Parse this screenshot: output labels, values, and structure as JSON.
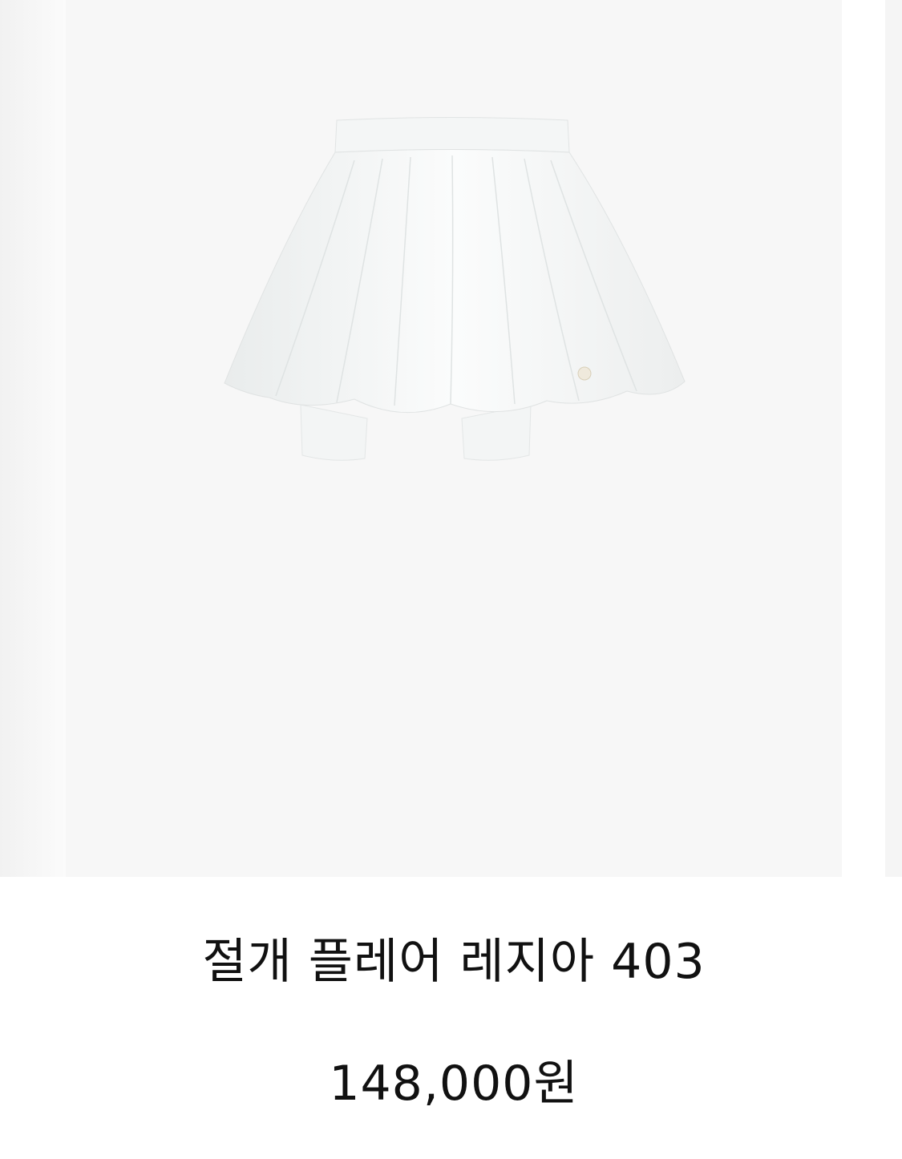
{
  "product": {
    "name": "절개 플레어 레지아 403",
    "price": "148,000원",
    "image_icon": "white-flare-skort-image"
  },
  "colors": {
    "image_background": "#f7f7f7",
    "text": "#111111"
  }
}
